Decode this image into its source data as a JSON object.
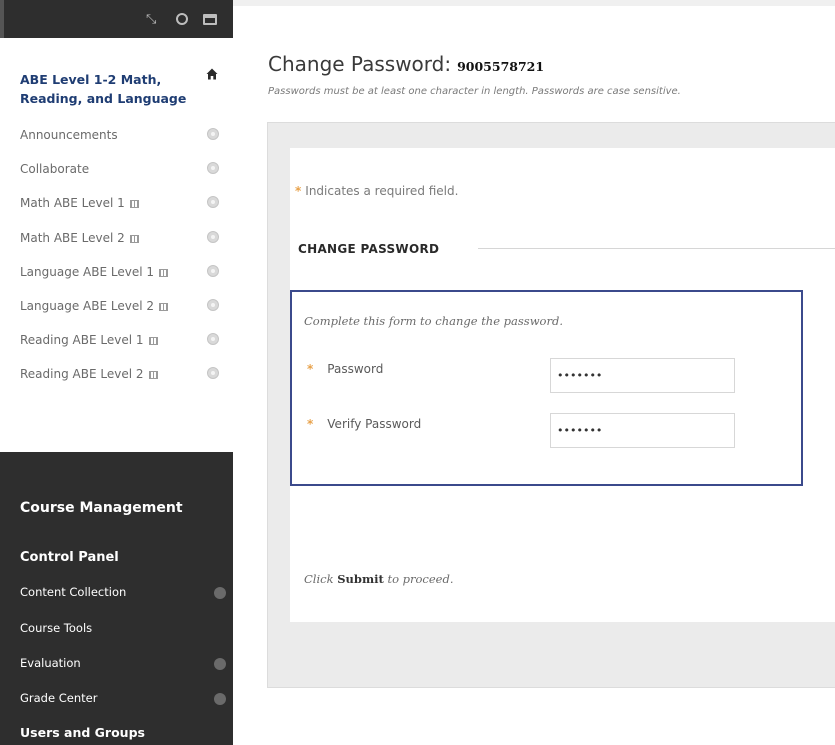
{
  "sidebar": {
    "course_title": "ABE Level 1-2 Math, Reading, and Language",
    "top_icons": [
      "expand-arrows-icon",
      "refresh-icon",
      "window-icon"
    ],
    "menu_items": [
      {
        "label": "Announcements",
        "hidden_badge": false
      },
      {
        "label": "Collaborate",
        "hidden_badge": false
      },
      {
        "label": "Math ABE Level 1",
        "hidden_badge": true
      },
      {
        "label": "Math ABE Level 2",
        "hidden_badge": true
      },
      {
        "label": "Language ABE Level 1",
        "hidden_badge": true
      },
      {
        "label": "Language ABE Level 2",
        "hidden_badge": true
      },
      {
        "label": "Reading ABE Level 1",
        "hidden_badge": true
      },
      {
        "label": "Reading ABE Level 2",
        "hidden_badge": true
      }
    ],
    "course_management": {
      "title": "Course Management",
      "control_panel": "Control Panel",
      "items": [
        {
          "label": "Content Collection",
          "expandable": true
        },
        {
          "label": "Course Tools",
          "expandable": false
        },
        {
          "label": "Evaluation",
          "expandable": true
        },
        {
          "label": "Grade Center",
          "expandable": true
        }
      ],
      "users_and_groups": "Users and Groups"
    }
  },
  "main": {
    "title": "Change Password:",
    "username": "9005578721",
    "subtitle": "Passwords must be at least one character in length. Passwords are case sensitive.",
    "required_note": "Indicates a required field.",
    "required_marker": "*",
    "section_title": "CHANGE PASSWORD",
    "form_description": "Complete this form to change the password.",
    "fields": [
      {
        "label": "Password",
        "value": "•••••••"
      },
      {
        "label": "Verify Password",
        "value": "•••••••"
      }
    ],
    "proceed_prefix": "Click",
    "proceed_bold": "Submit",
    "proceed_suffix": "to proceed."
  },
  "colors": {
    "sidebar_dark": "#2e2e2e",
    "course_title": "#1f3d73",
    "form_border": "#3b4a8c",
    "required_star": "#e8a24b"
  }
}
